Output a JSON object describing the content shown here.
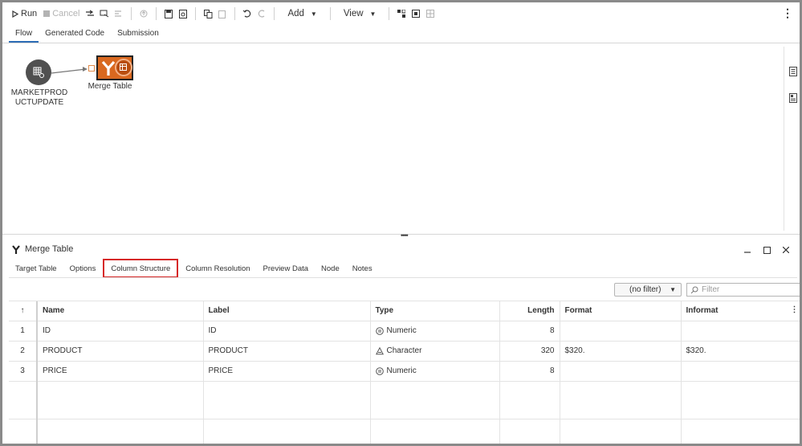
{
  "toolbar": {
    "run": "Run",
    "cancel": "Cancel",
    "add": "Add",
    "view": "View"
  },
  "top_tabs": [
    "Flow",
    "Generated Code",
    "Submission"
  ],
  "flow": {
    "source_node_line1": "MARKETPROD",
    "source_node_line2": "UCTUPDATE",
    "merge_node_label": "Merge Table"
  },
  "pane": {
    "title": "Merge Table",
    "tabs": [
      "Target Table",
      "Options",
      "Column Structure",
      "Column Resolution",
      "Preview Data",
      "Node",
      "Notes"
    ],
    "active_tab": "Column Structure",
    "filter_select": "(no filter)",
    "filter_placeholder": "Filter"
  },
  "table": {
    "headers": {
      "sort": "↑",
      "name": "Name",
      "label": "Label",
      "type": "Type",
      "length": "Length",
      "format": "Format",
      "informat": "Informat"
    },
    "rows": [
      {
        "idx": "1",
        "name": "ID",
        "label": "ID",
        "type": "Numeric",
        "type_icon": "numeric-icon",
        "length": "8",
        "format": "",
        "informat": ""
      },
      {
        "idx": "2",
        "name": "PRODUCT",
        "label": "PRODUCT",
        "type": "Character",
        "type_icon": "character-icon",
        "length": "320",
        "format": "$320.",
        "informat": "$320."
      },
      {
        "idx": "3",
        "name": "PRICE",
        "label": "PRICE",
        "type": "Numeric",
        "type_icon": "numeric-icon",
        "length": "8",
        "format": "",
        "informat": ""
      }
    ]
  },
  "colors": {
    "merge_node": "#d9681f",
    "active_tab_underline": "#2d6cb5",
    "highlight_box": "#d62828",
    "source_node": "#505050"
  }
}
